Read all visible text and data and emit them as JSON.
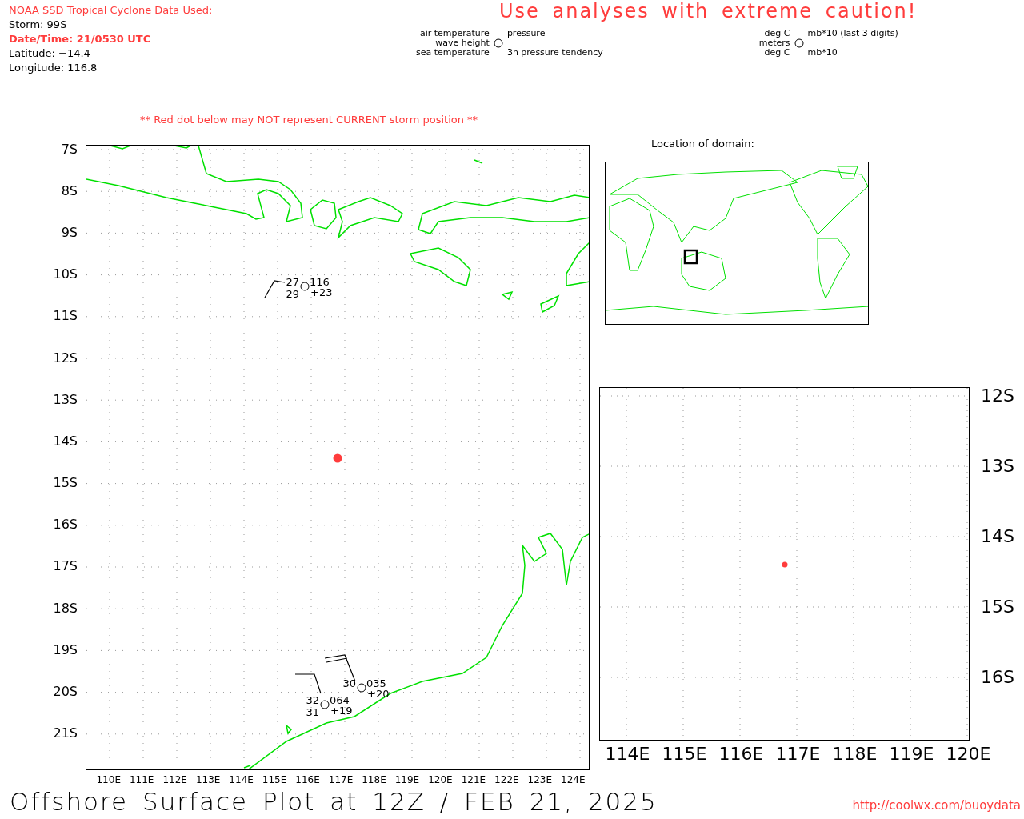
{
  "header": {
    "source_title": "NOAA SSD Tropical Cyclone Data Used:",
    "storm": "Storm: 99S",
    "date_time": "Date/Time: 21/0530 UTC",
    "latitude": "Latitude: −14.4",
    "longitude": "Longitude: 116.8"
  },
  "caution": "Use analyses with extreme caution!",
  "legend": [
    {
      "top_left": "air temperature",
      "top_right": "pressure",
      "middle_left": "wave height",
      "bottom_left": "sea temperature",
      "bottom_right": "3h pressure tendency"
    },
    {
      "top_left": "deg C",
      "top_right": "mb*10 (last 3 digits)",
      "middle_left": "meters",
      "bottom_left": "deg C",
      "bottom_right": "mb*10"
    }
  ],
  "warning": "** Red dot below may NOT represent CURRENT storm position **",
  "main_map": {
    "lat_labels": [
      "7S",
      "8S",
      "9S",
      "10S",
      "11S",
      "12S",
      "13S",
      "14S",
      "15S",
      "16S",
      "17S",
      "18S",
      "19S",
      "20S",
      "21S"
    ],
    "lon_labels": [
      "110E",
      "111E",
      "112E",
      "113E",
      "114E",
      "115E",
      "116E",
      "117E",
      "118E",
      "119E",
      "120E",
      "121E",
      "122E",
      "123E",
      "124E"
    ],
    "stations": [
      {
        "air_temp": "27",
        "sea_temp": "29",
        "pressure": "116",
        "tendency": "+23"
      },
      {
        "air_temp": "30",
        "pressure": "035",
        "tendency": "+20"
      },
      {
        "air_temp": "32",
        "sea_temp": "31",
        "pressure": "064",
        "tendency": "+19"
      }
    ]
  },
  "domain": {
    "title": "Location of domain:"
  },
  "inset_map": {
    "lat_labels": [
      "12S",
      "13S",
      "14S",
      "15S",
      "16S"
    ],
    "lon_labels": [
      "114E",
      "115E",
      "116E",
      "117E",
      "118E",
      "119E",
      "120E"
    ]
  },
  "footer": {
    "title": "Offshore Surface Plot at 12Z / FEB 21, 2025",
    "url": "http://coolwx.com/buoydata"
  }
}
